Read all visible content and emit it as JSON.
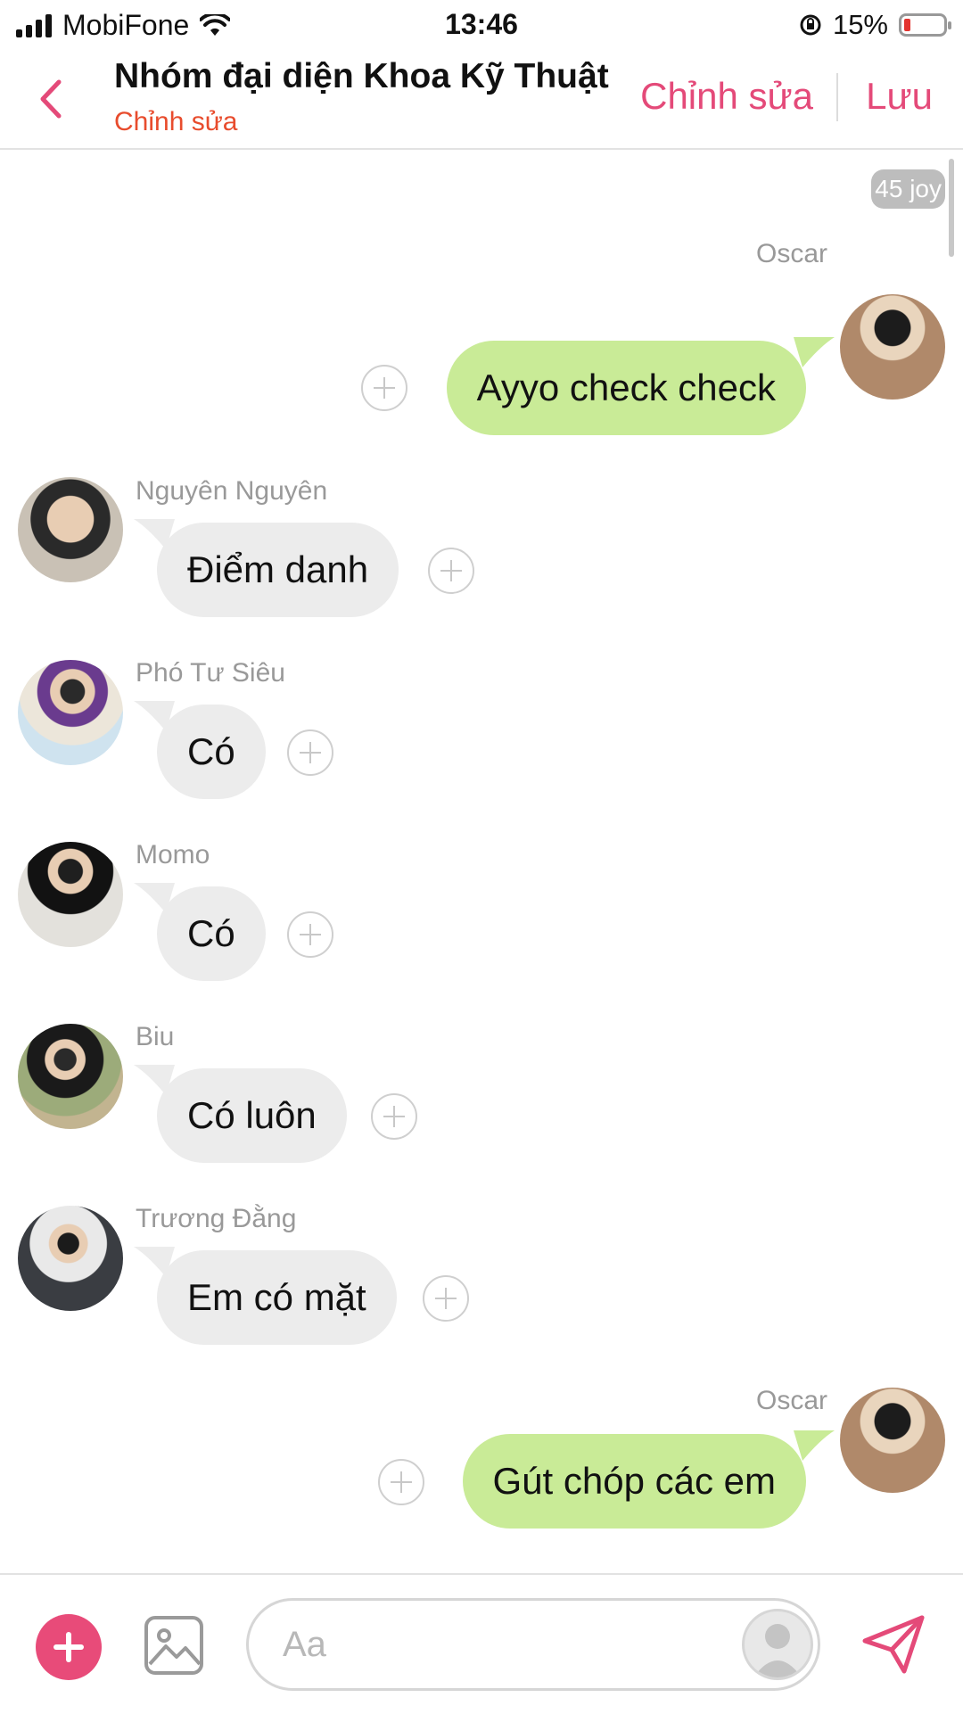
{
  "status_bar": {
    "carrier": "MobiFone",
    "time": "13:46",
    "battery": "15%",
    "battery_level": 0.15
  },
  "header": {
    "title": "Nhóm đại diện Khoa Kỹ Thuật",
    "subtitle": "Chỉnh sửa",
    "edit_label": "Chỉnh sửa",
    "save_label": "Lưu"
  },
  "chat": {
    "badge": "45 joy",
    "messages": [
      {
        "sender": "Oscar",
        "text": "Ayyo check check",
        "direction": "out"
      },
      {
        "sender": "Nguyên Nguyên",
        "text": "Điểm danh",
        "direction": "in"
      },
      {
        "sender": "Phó Tư Siêu",
        "text": "Có",
        "direction": "in"
      },
      {
        "sender": "Momo",
        "text": "Có",
        "direction": "in"
      },
      {
        "sender": "Biu",
        "text": "Có luôn",
        "direction": "in"
      },
      {
        "sender": "Trương Đằng",
        "text": "Em có mặt",
        "direction": "in"
      },
      {
        "sender": "Oscar",
        "text": "Gút chóp các em",
        "direction": "out"
      }
    ]
  },
  "composer": {
    "placeholder": "Aa"
  },
  "colors": {
    "accent": "#e44a79",
    "subtitle": "#e84c2d",
    "outgoing_bubble": "#c9eb97",
    "incoming_bubble": "#ececec"
  },
  "icons": {
    "back": "chevron-left-icon",
    "add": "plus-icon",
    "image": "image-icon",
    "send": "paper-plane-icon",
    "message_action": "circle-plus-icon"
  }
}
